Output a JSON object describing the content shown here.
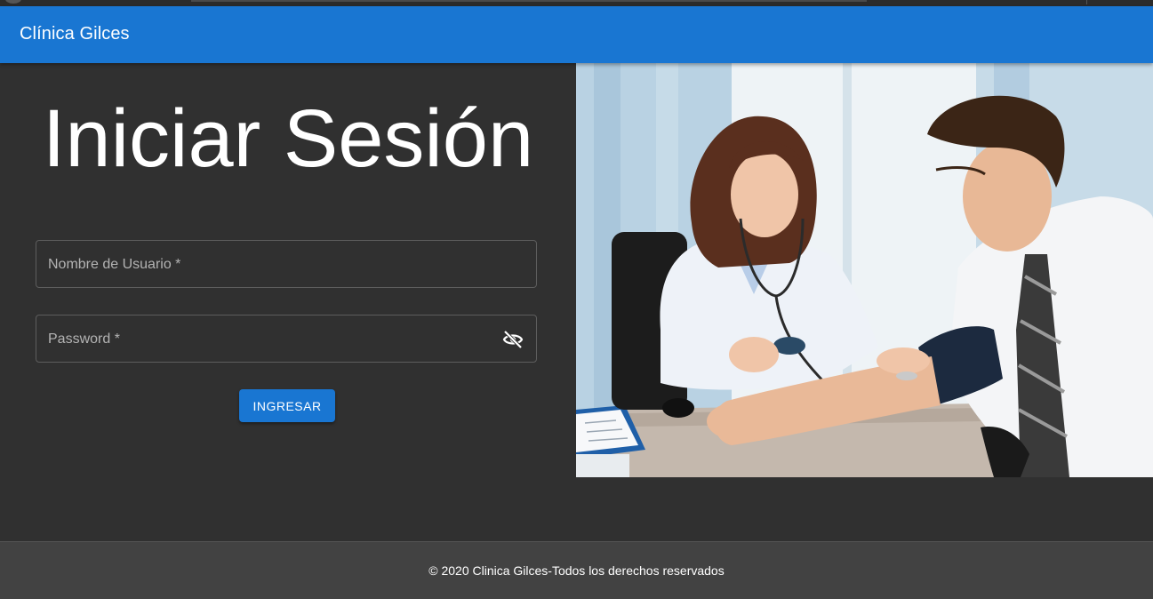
{
  "app": {
    "title": "Clínica Gilces"
  },
  "login": {
    "heading": "Iniciar Sesión",
    "username_label": "Nombre de Usuario *",
    "password_label": "Password *",
    "password_toggle_icon": "visibility-off-icon",
    "submit_label": "INGRESAR"
  },
  "hero": {
    "image": "doctor-measuring-blood-pressure-photo"
  },
  "footer": {
    "copyright": "© 2020 Clinica Gilces-Todos los derechos reservados"
  },
  "colors": {
    "primary": "#1976d2",
    "background": "#303030",
    "footer": "#424242"
  }
}
